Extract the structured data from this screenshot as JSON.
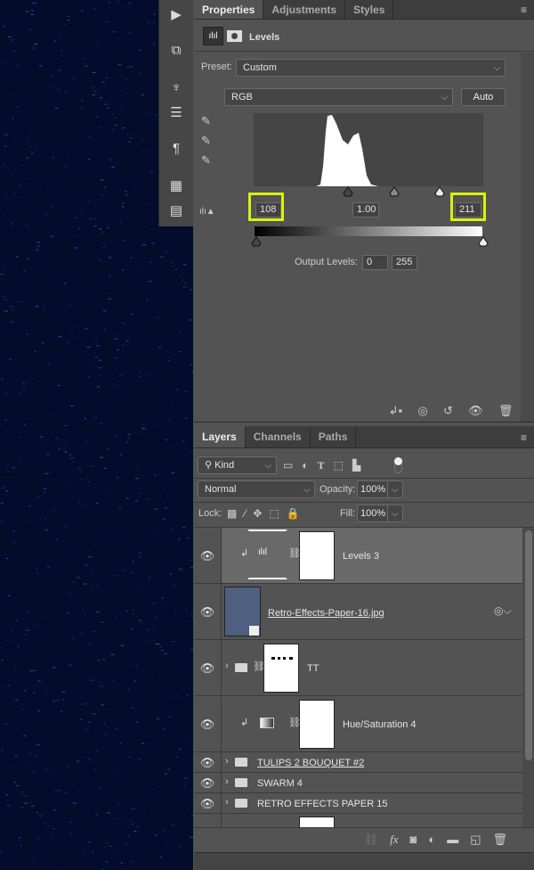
{
  "toolstrip": {
    "icons": [
      "play-icon",
      "swap-icon",
      "brush-presets-icon",
      "sliders-icon",
      "paragraph-icon",
      "panel-layout-icon",
      "notes-icon"
    ]
  },
  "properties": {
    "tabs": [
      "Properties",
      "Adjustments",
      "Styles"
    ],
    "active_tab": "Properties",
    "title": "Levels",
    "preset_label": "Preset:",
    "preset_value": "Custom",
    "channel_value": "RGB",
    "auto_label": "Auto",
    "input_black": "108",
    "input_gamma": "1.00",
    "input_white": "211",
    "output_label": "Output Levels:",
    "output_black": "0",
    "output_white": "255",
    "highlight_color": "#d9f20a"
  },
  "layers": {
    "tabs": [
      "Layers",
      "Channels",
      "Paths"
    ],
    "active_tab": "Layers",
    "filter_value": "Kind",
    "blend_mode": "Normal",
    "opacity_label": "Opacity:",
    "opacity_value": "100%",
    "lock_label": "Lock:",
    "fill_label": "Fill:",
    "fill_value": "100%",
    "items": [
      {
        "name": "Levels 3",
        "type": "adjustment-levels",
        "selected": true
      },
      {
        "name": "Retro-Effects-Paper-16.jpg",
        "type": "smart-object"
      },
      {
        "name": "TT",
        "type": "group-masked"
      },
      {
        "name": "Hue/Saturation 4",
        "type": "adjustment-hue"
      },
      {
        "name": "TULIPS 2 BOUQUET #2",
        "type": "group"
      },
      {
        "name": "SWARM 4",
        "type": "group"
      },
      {
        "name": "RETRO EFFECTS PAPER 15",
        "type": "group"
      }
    ]
  }
}
